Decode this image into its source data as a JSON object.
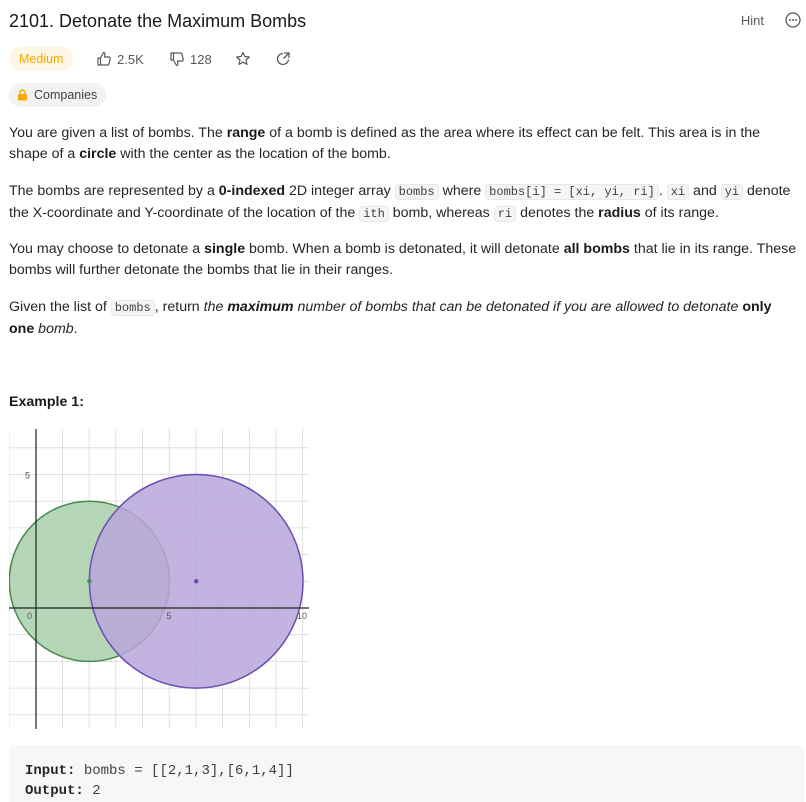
{
  "problem": {
    "title": "2101. Detonate the Maximum Bombs",
    "hint_label": "Hint",
    "difficulty": "Medium",
    "likes": "2.5K",
    "dislikes": "128",
    "companies_label": "Companies"
  },
  "description": {
    "p1": [
      "You are given a list of bombs. The ",
      "range",
      " of a bomb is defined as the area where its effect can be felt. This area is in the shape of a ",
      "circle",
      " with the center as the location of the bomb."
    ],
    "p2": {
      "t1": "The bombs are represented by a ",
      "b1": "0-indexed",
      "t2": " 2D integer array ",
      "c1": "bombs",
      "t3": " where ",
      "c2": "bombs[i] = [xi, yi, ri]",
      "t4": ". ",
      "c3": "xi",
      "t5": " and ",
      "c4": "yi",
      "t6": " denote the X-coordinate and Y-coordinate of the location of the ",
      "c5": "ith",
      "t7": " bomb, whereas ",
      "c6": "ri",
      "t8": " denotes the ",
      "b2": "radius",
      "t9": " of its range."
    },
    "p3": [
      "You may choose to detonate a ",
      "single",
      " bomb. When a bomb is detonated, it will detonate ",
      "all bombs",
      " that lie in its range. These bombs will further detonate the bombs that lie in their ranges."
    ],
    "p4": {
      "t1": "Given the list of ",
      "c1": "bombs",
      "t2": ", return ",
      "i1": "the ",
      "b1": "maximum",
      "i2": " number of bombs that can be detonated if you are allowed to detonate ",
      "b2": "only one",
      "i3": " bomb",
      "t3": "."
    }
  },
  "example1": {
    "title": "Example 1:",
    "input_label": "Input:",
    "input_value": "bombs = [[2,1,3],[6,1,4]]",
    "output_label": "Output:",
    "output_value": "2",
    "figure": {
      "tick_labels": [
        "0",
        "5",
        "10",
        "5"
      ],
      "bombs": [
        {
          "x": 2,
          "y": 1,
          "r": 3,
          "fill": "#a8cfaa",
          "stroke": "#4a8a4f"
        },
        {
          "x": 6,
          "y": 1,
          "r": 4,
          "fill": "#b7a6da",
          "stroke": "#6a4fb0"
        }
      ]
    }
  },
  "colors": {
    "medium": "#f2a900",
    "medium_bg": "#fef6e4"
  },
  "icons": [
    "thumbs-up-icon",
    "thumbs-down-icon",
    "star-icon",
    "share-icon",
    "lock-icon",
    "more-icon"
  ]
}
